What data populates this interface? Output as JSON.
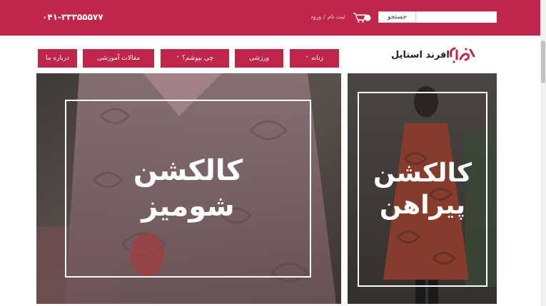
{
  "header": {
    "phone": "۰۴۱-۳۳۳۵۵۵۷۷",
    "search_button": "جستجو",
    "search_placeholder": "",
    "login": "ورود",
    "separator": "/",
    "register": "ثبت نام"
  },
  "brand": {
    "name": "افرند استایل"
  },
  "nav": [
    {
      "label": "زنانه",
      "chevron": "˅"
    },
    {
      "label": "ورزشی",
      "chevron": ""
    },
    {
      "label": "چی بپوشم؟",
      "chevron": "˅"
    },
    {
      "label": "مقالات آموزشی",
      "chevron": ""
    },
    {
      "label": "درباره ما",
      "chevron": ""
    }
  ],
  "banners": {
    "left": {
      "line1": "کالکشن",
      "line2": "شومیز"
    },
    "right": {
      "line1": "کالکشن",
      "line2": "پیراهن"
    }
  },
  "colors": {
    "brand": "#c0264a"
  }
}
